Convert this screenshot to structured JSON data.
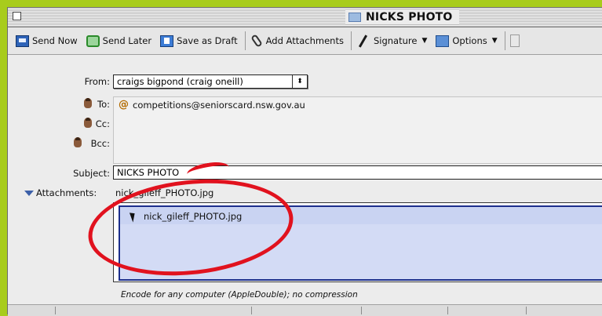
{
  "window": {
    "title": "NICKS PHOTO"
  },
  "toolbar": {
    "send_now": "Send Now",
    "send_later": "Send Later",
    "save_draft": "Save as Draft",
    "add_attachments": "Add Attachments",
    "signature": "Signature",
    "options": "Options"
  },
  "header": {
    "from_label": "From:",
    "from_value": "craigs bigpond (craig oneill)",
    "to_label": "To:",
    "to_value": "competitions@seniorscard.nsw.gov.au",
    "cc_label": "Cc:",
    "bcc_label": "Bcc:",
    "subject_label": "Subject:",
    "subject_value": "NICKS PHOTO",
    "attachments_label": "Attachments:",
    "attachments_summary": "nick_gileff_PHOTO.jpg"
  },
  "attachments": [
    {
      "name": "nick_gileff_PHOTO.jpg"
    }
  ],
  "encoding_text": "Encode for any computer (AppleDouble); no compression",
  "colors": {
    "highlight": "#e1121e",
    "selection": "#c9d3f2",
    "background": "#a8cc1c"
  }
}
